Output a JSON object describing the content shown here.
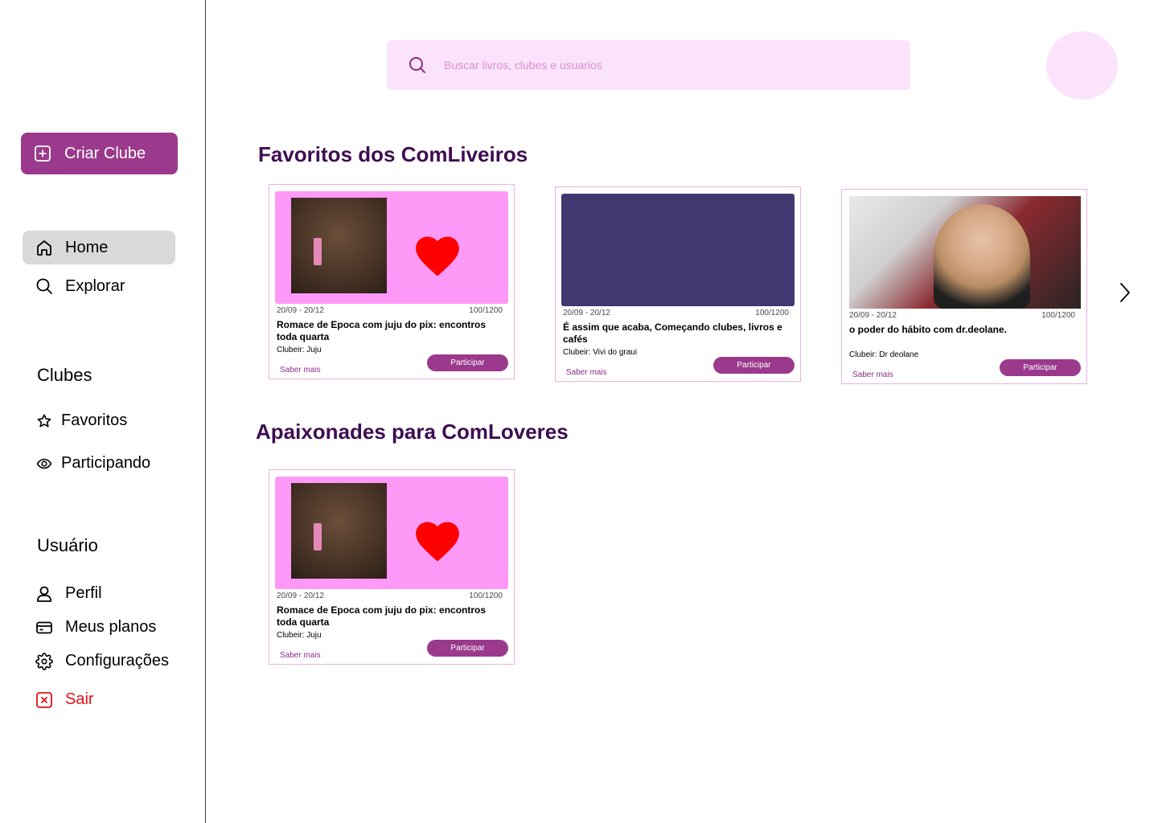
{
  "sidebar": {
    "create_button": {
      "label": "Criar Clube",
      "icon": "plus-square-icon"
    },
    "nav": [
      {
        "label": "Home",
        "icon": "home-icon",
        "active": true
      },
      {
        "label": "Explorar",
        "icon": "search-icon",
        "active": false
      }
    ],
    "clubs_section": {
      "title": "Clubes",
      "items": [
        {
          "label": "Favoritos",
          "icon": "star-icon"
        },
        {
          "label": "Participando",
          "icon": "eye-icon"
        }
      ]
    },
    "user_section": {
      "title": "Usuário",
      "items": [
        {
          "label": "Perfil",
          "icon": "user-icon"
        },
        {
          "label": "Meus planos",
          "icon": "credit-card-icon"
        },
        {
          "label": "Configurações",
          "icon": "gear-icon"
        }
      ],
      "logout": {
        "label": "Sair",
        "icon": "close-square-icon",
        "color": "#e0101a"
      }
    }
  },
  "header": {
    "search": {
      "placeholder": "Buscar livros, clubes e usuarios",
      "value": ""
    }
  },
  "sections": [
    {
      "title": "Favoritos dos ComLiveiros",
      "cards": [
        {
          "dates": "20/09 - 20/12",
          "count": "100/1200",
          "title": "Romace de Epoca com juju do pix:  encontros toda quarta",
          "owner": "Clubeir: Juju",
          "more": "Saber mais",
          "join": "Participar"
        },
        {
          "dates": "20/09 - 20/12",
          "count": "100/1200",
          "title": "É assim que acaba, Começando clubes, livros e cafés",
          "owner": "Clubeir: Vivi do graui",
          "more": "Saber mais",
          "join": "Participar"
        },
        {
          "dates": "20/09 - 20/12",
          "count": "100/1200",
          "title": "o poder do hábito com dr.deolane.",
          "owner": "Clubeir: Dr deolane",
          "more": "Saber mais",
          "join": "Participar"
        }
      ]
    },
    {
      "title": "Apaixonades para  ComLoveres",
      "cards": [
        {
          "dates": "20/09 - 20/12",
          "count": "100/1200",
          "title": "Romace de Epoca com juju do pix:  encontros toda quarta",
          "owner": "Clubeir: Juju",
          "more": "Saber mais",
          "join": "Participar"
        }
      ]
    }
  ],
  "colors": {
    "primary": "#9b3a8c",
    "heading": "#3e0d52",
    "search_bg": "#fbe3fb",
    "card_pink": "#ff99f8",
    "card_navy": "#3f3871",
    "heart": "#ff0000"
  }
}
